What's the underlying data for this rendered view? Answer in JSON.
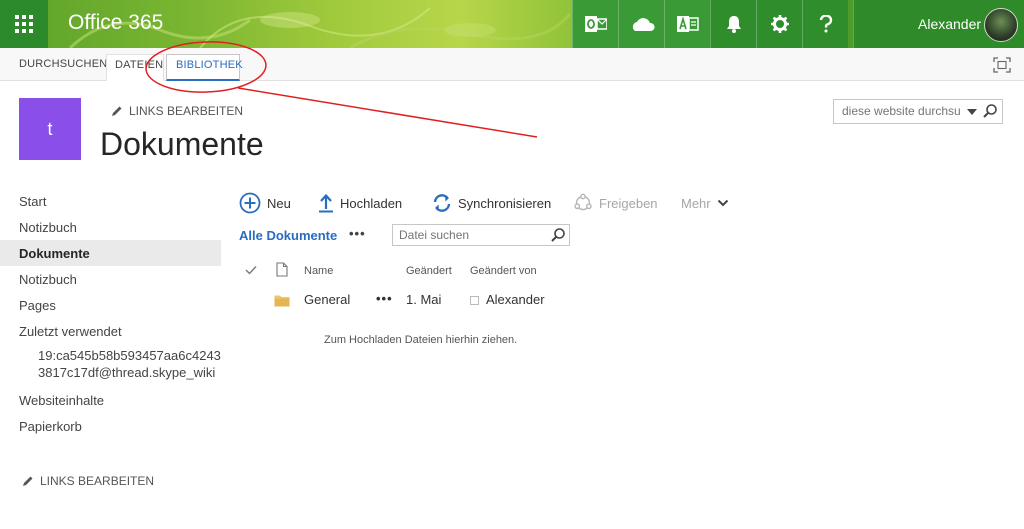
{
  "suitebar": {
    "brand": "Office 365",
    "user_name": "Alexander",
    "icons": [
      "outlook-icon",
      "onedrive-icon",
      "access-icon",
      "bell-icon",
      "gear-icon",
      "help-icon"
    ]
  },
  "ribbon": {
    "tabs": [
      "DURCHSUCHEN",
      "DATEIEN",
      "BIBLIOTHEK"
    ],
    "active_tab": "BIBLIOTHEK"
  },
  "header": {
    "site_logo_letter": "t",
    "edit_links": "LINKS BEARBEITEN",
    "page_title": "Dokumente",
    "search_placeholder": "diese website durchsuc"
  },
  "leftnav": {
    "items": [
      "Start",
      "Notizbuch",
      "Dokumente",
      "Notizbuch",
      "Pages",
      "Zuletzt verwendet",
      "19:ca545b58b593457aa6c42433817c17df@thread.skype_wiki",
      "Websiteinhalte",
      "Papierkorb"
    ],
    "selected": "Dokumente",
    "edit_links": "LINKS BEARBEITEN"
  },
  "commands": {
    "new": "Neu",
    "upload": "Hochladen",
    "sync": "Synchronisieren",
    "share": "Freigeben",
    "more": "Mehr"
  },
  "views": {
    "current": "Alle Dokumente",
    "dots": "•••",
    "search_placeholder": "Datei suchen"
  },
  "table": {
    "headers": [
      "Name",
      "Geändert",
      "Geändert von"
    ],
    "rows": [
      {
        "name": "General",
        "modified": "1. Mai",
        "modified_by": "Alexander",
        "menu": "•••"
      }
    ],
    "drop_hint": "Zum Hochladen Dateien hierhin ziehen."
  },
  "colors": {
    "accent_blue": "#2a6cbf",
    "site_logo": "#8a4fe8",
    "suite_green": "#2f8a2a",
    "annotation_red": "#e02020"
  }
}
